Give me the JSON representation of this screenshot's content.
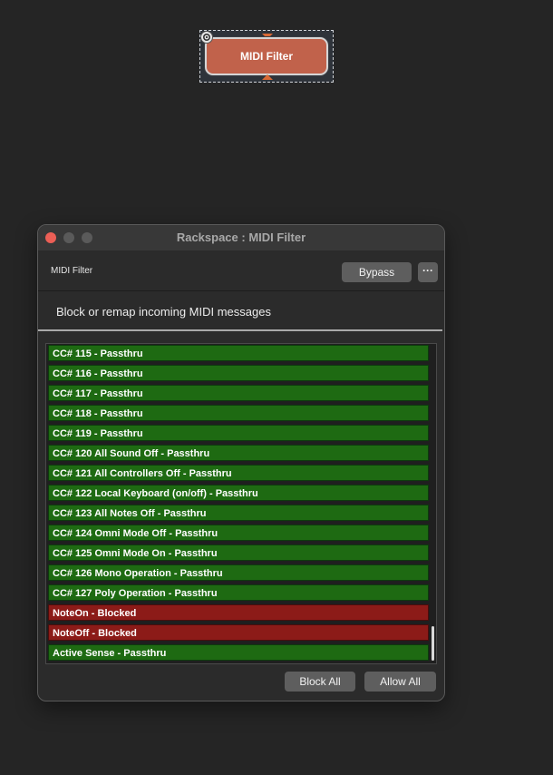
{
  "canvas": {
    "plugin_block": {
      "label": "MIDI Filter",
      "accent": "#c1624b",
      "pin_color": "#d96a36",
      "settings_icon": "gear-icon"
    }
  },
  "window": {
    "title": "Rackspace : MIDI Filter",
    "controls": [
      "close",
      "minimize",
      "maximize"
    ],
    "header": {
      "plugin_name": "MIDI Filter",
      "bypass_label": "Bypass",
      "more_label": "···"
    },
    "subtitle": "Block or remap incoming MIDI messages",
    "rows": [
      {
        "label": "CC# 115 - Passthru",
        "state": "passthru"
      },
      {
        "label": "CC# 116 - Passthru",
        "state": "passthru"
      },
      {
        "label": "CC# 117 - Passthru",
        "state": "passthru"
      },
      {
        "label": "CC# 118 - Passthru",
        "state": "passthru"
      },
      {
        "label": "CC# 119 - Passthru",
        "state": "passthru"
      },
      {
        "label": "CC# 120 All Sound Off - Passthru",
        "state": "passthru"
      },
      {
        "label": "CC# 121 All Controllers Off - Passthru",
        "state": "passthru"
      },
      {
        "label": "CC# 122 Local Keyboard (on/off) - Passthru",
        "state": "passthru"
      },
      {
        "label": "CC# 123 All Notes Off - Passthru",
        "state": "passthru"
      },
      {
        "label": "CC# 124 Omni Mode Off - Passthru",
        "state": "passthru"
      },
      {
        "label": "CC# 125 Omni Mode On - Passthru",
        "state": "passthru"
      },
      {
        "label": "CC# 126 Mono Operation - Passthru",
        "state": "passthru"
      },
      {
        "label": "CC# 127 Poly Operation - Passthru",
        "state": "passthru"
      },
      {
        "label": "NoteOn - Blocked",
        "state": "blocked"
      },
      {
        "label": "NoteOff - Blocked",
        "state": "blocked"
      },
      {
        "label": "Active Sense - Passthru",
        "state": "passthru"
      }
    ],
    "footer": {
      "block_all_label": "Block All",
      "allow_all_label": "Allow All"
    },
    "colors": {
      "passthru": "#1e6a12",
      "blocked": "#8c1b18",
      "close_button": "#ec5f56"
    }
  }
}
